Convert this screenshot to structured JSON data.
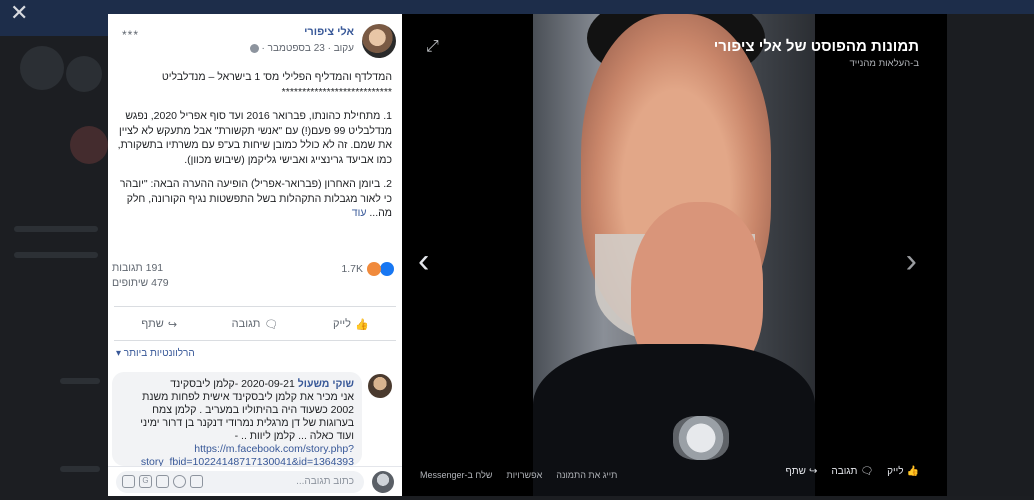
{
  "close": {
    "symbol": "✕"
  },
  "post": {
    "author": "אלי ציפורי",
    "meta": "עקוב · 23 בספטמבר ·",
    "dots": "***",
    "paragraphs": [
      "המדלדף והמדליף הפלילי מס' 1 בישראל – מנדלבליט ***************************",
      "1. מתחילת כהונתו, פברואר 2016 ועד סוף אפריל 2020, נפגש מנדלבליט 99 פעם(!) עם \"אנשי תקשורת\" אבל מתעקש לא לציין את שמם. זה לא כולל כמובן שיחות בע\"פ עם משרתיו בתשקורת, כמו אביעד גרינצייג ואבישי גליקמן (שיבוש מכוון).",
      "2. ביומן האחרון (פברואר-אפריל) הופיעה ההערה הבאה: \"יובהר כי לאור מגבלות התקהלות בשל התפשטות נגיף הקורונה, חלק מה..."
    ],
    "more": "עוד",
    "reactions_count": "1.7K",
    "comments_count": "191 תגובות",
    "shares_count": "479 שיתופים",
    "actions": {
      "like": "לייק",
      "comment": "תגובה",
      "share": "שתף"
    },
    "relevant": "הרלוונטיות ביותר ▾"
  },
  "comment": {
    "name": "שוקי משעול",
    "text_lines": [
      "2020-09-21 -קלמן ליבסקינד",
      "אני מכיר את קלמן ליבסקינד אישית לפחות משנת 2002 כשעוד היה בהיתוליו במעריב . קלמן צמח בערוגות של דן מרגלית נמרודי דנקנר בן דרור ימיני ועוד כאלה ... קלמן ליוות .. -"
    ],
    "link": "https://m.facebook.com/story.php?story_fbid=10224148717130041&id=1364393"
  },
  "input": {
    "placeholder": "כתוב תגובה..."
  },
  "viewer": {
    "title": "תמונות מהפוסט של אלי ציפורי",
    "subtitle": "ב-העלאות מהנייד",
    "actions": {
      "like": "לייק",
      "comment": "תגובה",
      "share": "שתף"
    },
    "links": {
      "tag": "תייג את התמונה",
      "options": "אפשרויות",
      "messenger": "שלח ב-Messenger"
    },
    "prev": "‹",
    "next": "›",
    "expand": "⤢"
  }
}
